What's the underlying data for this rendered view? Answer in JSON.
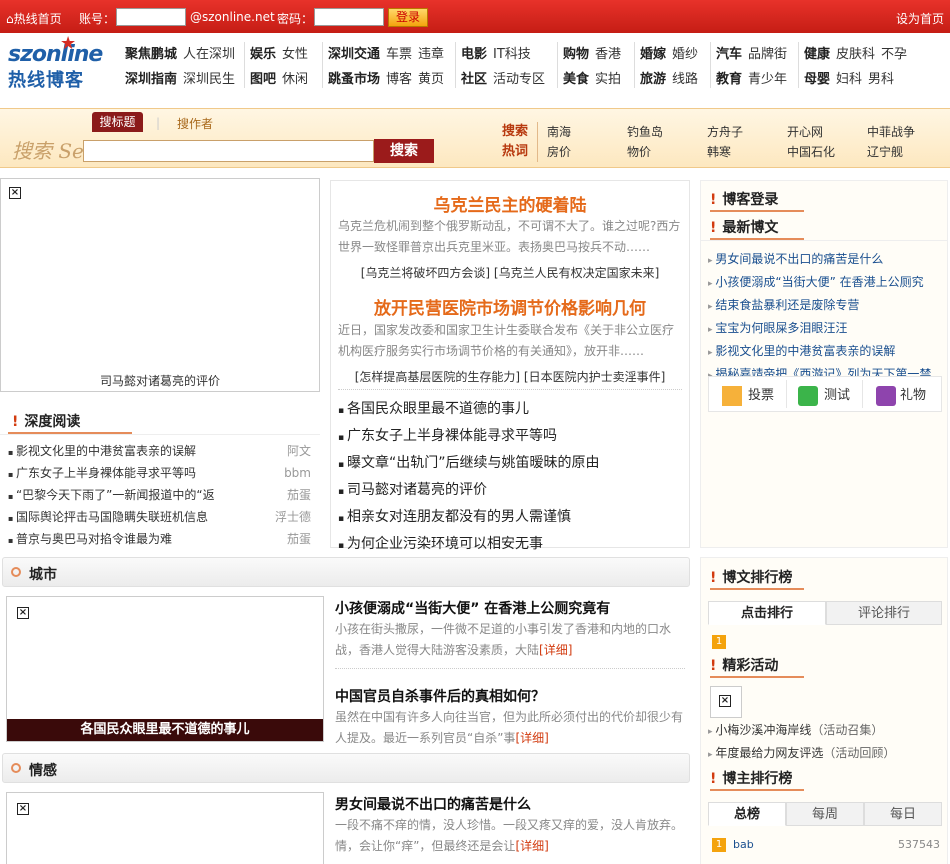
{
  "topbar": {
    "home": "热线首页",
    "account_label": "账号：",
    "domain": "@szonline.net",
    "password_label": "密码：",
    "login": "登录",
    "set_home": "设为首页"
  },
  "logo": {
    "line1": "szonline",
    "line2": "热线博客"
  },
  "nav": [
    {
      "r1": [
        "聚焦鹏城",
        "人在深圳"
      ],
      "r2": [
        "深圳指南",
        "深圳民生"
      ]
    },
    {
      "r1": [
        "娱乐",
        "女性"
      ],
      "r2": [
        "图吧",
        "休闲"
      ]
    },
    {
      "r1": [
        "深圳交通",
        "车票",
        "违章"
      ],
      "r2": [
        "跳蚤市场",
        "博客",
        "黄页"
      ]
    },
    {
      "r1": [
        "电影",
        "IT科技"
      ],
      "r2": [
        "社区",
        "活动专区"
      ]
    },
    {
      "r1": [
        "购物",
        "香港"
      ],
      "r2": [
        "美食",
        "实拍"
      ]
    },
    {
      "r1": [
        "婚嫁",
        "婚纱"
      ],
      "r2": [
        "旅游",
        "线路"
      ]
    },
    {
      "r1": [
        "汽车",
        "品牌街"
      ],
      "r2": [
        "教育",
        "青少年"
      ]
    },
    {
      "r1": [
        "健康",
        "皮肤科",
        "不孕"
      ],
      "r2": [
        "母婴",
        "妇科",
        "男科"
      ]
    }
  ],
  "search": {
    "logo_text": "搜索 Search",
    "tab_title": "搜标题",
    "tab_author": "搜作者",
    "button": "搜索",
    "hot_label1": "搜索",
    "hot_label2": "热词",
    "hot_words": [
      "南海",
      "钓鱼岛",
      "方舟子",
      "开心网",
      "中菲战争",
      "房价",
      "物价",
      "韩寒",
      "中国石化",
      "辽宁舰"
    ]
  },
  "left_image_caption": "司马懿对诸葛亮的评价",
  "deep_read": {
    "title": "深度阅读",
    "items": [
      {
        "t": "影视文化里的中港贫富表亲的误解",
        "a": "阿文"
      },
      {
        "t": "广东女子上半身裸体能寻求平等吗",
        "a": "bbm"
      },
      {
        "t": "“巴黎今天下雨了”一新闻报道中的“返",
        "a": "茄蛋"
      },
      {
        "t": "国际舆论抨击马国隐瞒失联班机信息",
        "a": "浮士德"
      },
      {
        "t": "普京与奥巴马对掐令谁最为难",
        "a": "茄蛋"
      }
    ]
  },
  "feature": {
    "h1": "乌克兰民主的硬着陆",
    "s1": "乌克兰危机闹到整个俄罗斯动乱，不可谓不大了。谁之过呢?西方世界一致怪罪普京出兵克里米亚。表扬奥巴马按兵不动……",
    "l1": "[乌克兰将破坏四方会谈]  [乌克兰人民有权决定国家未来]",
    "h2": "放开民营医院市场调节价格影响几何",
    "s2": "近日，国家发改委和国家卫生计生委联合发布《关于非公立医疗机构医疗服务实行市场调节价格的有关通知》，放开非……",
    "l2": "[怎样提高基层医院的生存能力]  [日本医院内护士卖淫事件]",
    "list": [
      "各国民众眼里最不道德的事儿",
      "广东女子上半身裸体能寻求平等吗",
      "曝文章“出轨门”后继续与姚笛暧昧的原由",
      "司马懿对诸葛亮的评价",
      "相亲女对连朋友都没有的男人需谨慎",
      "为何企业污染环境可以相安无事"
    ]
  },
  "right": {
    "login_title": "博客登录",
    "newest_title": "最新博文",
    "newest": [
      "男女间最说不出口的痛苦是什么",
      "小孩便溺成“当街大便” 在香港上公厕究",
      "结束食盐暴利还是废除专营",
      "宝宝为何眼屎多泪眼汪汪",
      "影视文化里的中港贫富表亲的误解",
      "揭秘嘉靖帝把《西游记》列为天下第一禁"
    ],
    "tools": [
      "投票",
      "测试",
      "礼物"
    ],
    "rank_title": "博文排行榜",
    "rank_tabs": [
      "点击排行",
      "评论排行"
    ],
    "rank_first": "1",
    "events_title": "精彩活动",
    "events": [
      {
        "t": "小梅沙溪冲海岸线",
        "n": "（活动召集）"
      },
      {
        "t": "年度最给力网友评选",
        "n": "（活动回顾）"
      }
    ],
    "bloggers_title": "博主排行榜",
    "blogger_tabs": [
      "总榜",
      "每周",
      "每日"
    ],
    "blogger_first": {
      "rank": "1",
      "name": "bab",
      "score": "537543"
    }
  },
  "city": {
    "title": "城市",
    "img_caption": "各国民众眼里最不道德的事儿",
    "a1_title": "小孩便溺成“当街大便” 在香港上公厕究竟有",
    "a1_sum": "小孩在街头撒尿，一件微不足道的小事引发了香港和内地的口水战，香港人觉得大陆游客没素质，大陆",
    "a2_title": "中国官员自杀事件后的真相如何？",
    "a2_sum": "虽然在中国有许多人向往当官，但为此所必须付出的代价却很少有人提及。最近一系列官员“自杀”事",
    "more": "[详细]"
  },
  "emotion": {
    "title": "情感",
    "a1_title": "男女间最说不出口的痛苦是什么",
    "a1_sum": "一段不痛不痒的情，没人珍惜。一段又疼又痒的爱，没人肯放弃。情，会让你“痒”，但最终还是会让",
    "more": "[详细]"
  },
  "colors": {
    "topbar": "#d62b22",
    "accent": "#e56a1a",
    "link": "#1a4f8f"
  }
}
